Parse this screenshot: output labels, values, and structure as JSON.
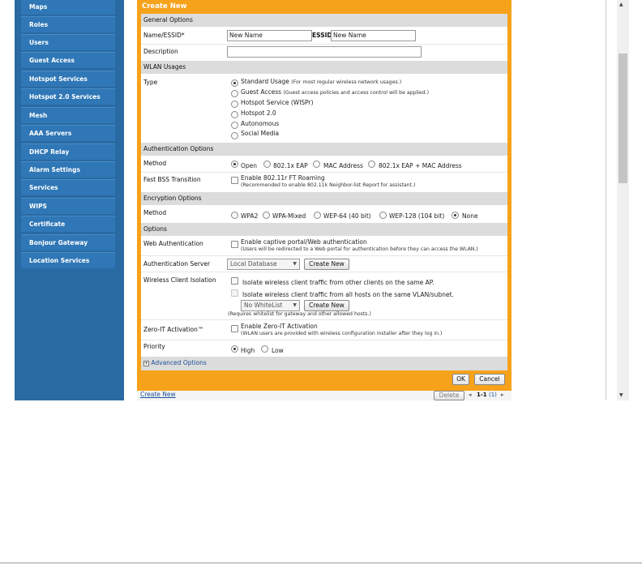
{
  "sidebar": {
    "items": [
      {
        "label": "Maps"
      },
      {
        "label": "Roles"
      },
      {
        "label": "Users"
      },
      {
        "label": "Guest Access"
      },
      {
        "label": "Hotspot Services"
      },
      {
        "label": "Hotspot 2.0 Services"
      },
      {
        "label": "Mesh"
      },
      {
        "label": "AAA Servers"
      },
      {
        "label": "DHCP Relay"
      },
      {
        "label": "Alarm Settings"
      },
      {
        "label": "Services"
      },
      {
        "label": "WIPS"
      },
      {
        "label": "Certificate"
      },
      {
        "label": "Bonjour Gateway"
      },
      {
        "label": "Location Services"
      }
    ]
  },
  "dialog": {
    "title": "Create New",
    "general": {
      "section": "General Options",
      "name_label": "Name/ESSID*",
      "name_value": "New Name",
      "essid_label": "ESSID",
      "essid_value": "New Name",
      "description_label": "Description",
      "description_value": ""
    },
    "wlan": {
      "section": "WLAN Usages",
      "type_label": "Type",
      "types": [
        {
          "label": "Standard Usage",
          "note": "(For most regular wireless network usages.)",
          "selected": true
        },
        {
          "label": "Guest Access",
          "note": "(Guest access policies and access control will be applied.)",
          "selected": false
        },
        {
          "label": "Hotspot Service (WISPr)",
          "note": "",
          "selected": false
        },
        {
          "label": "Hotspot 2.0",
          "note": "",
          "selected": false
        },
        {
          "label": "Autonomous",
          "note": "",
          "selected": false
        },
        {
          "label": "Social Media",
          "note": "",
          "selected": false
        }
      ]
    },
    "auth": {
      "section": "Authentication Options",
      "method_label": "Method",
      "methods": [
        {
          "label": "Open",
          "selected": true
        },
        {
          "label": "802.1x EAP",
          "selected": false
        },
        {
          "label": "MAC Address",
          "selected": false
        },
        {
          "label": "802.1x EAP + MAC Address",
          "selected": false
        }
      ],
      "fbt_label": "Fast BSS Transition",
      "fbt_option": "Enable 802.11r FT Roaming",
      "fbt_note": "(Recommended to enable 802.11k Neighbor-list Report for assistant.)"
    },
    "encryption": {
      "section": "Encryption Options",
      "method_label": "Method",
      "methods": [
        {
          "label": "WPA2",
          "selected": false
        },
        {
          "label": "WPA-Mixed",
          "selected": false
        },
        {
          "label": "WEP-64 (40 bit)",
          "selected": false
        },
        {
          "label": "WEP-128 (104 bit)",
          "selected": false
        },
        {
          "label": "None",
          "selected": true
        }
      ]
    },
    "options": {
      "section": "Options",
      "webauth_label": "Web Authentication",
      "webauth_option": "Enable captive portal/Web authentication",
      "webauth_note": "(Users will be redirected to a Web portal for authentication before they can access the WLAN.)",
      "authserver_label": "Authentication Server",
      "authserver_value": "Local Database",
      "create_new": "Create New",
      "isolation_label": "Wireless Client Isolation",
      "isolation_option1": "Isolate wireless client traffic from other clients on the same AP.",
      "isolation_option2": "Isolate wireless client traffic from all hosts on the same VLAN/subnet.",
      "whitelist_value": "No WhiteList",
      "whitelist_note": "(Requires whitelist for gateway and other allowed hosts.)",
      "zeroit_label": "Zero-IT Activation™",
      "zeroit_option": "Enable Zero-IT Activation",
      "zeroit_note": "(WLAN users are provided with wireless configuration installer after they log in.)",
      "priority_label": "Priority",
      "priority_high": "High",
      "priority_low": "Low",
      "advanced": "Advanced Options"
    },
    "ok": "OK",
    "cancel": "Cancel"
  },
  "footer": {
    "create_new": "Create New",
    "delete": "Delete",
    "range": "1-1",
    "count": "(1)"
  }
}
